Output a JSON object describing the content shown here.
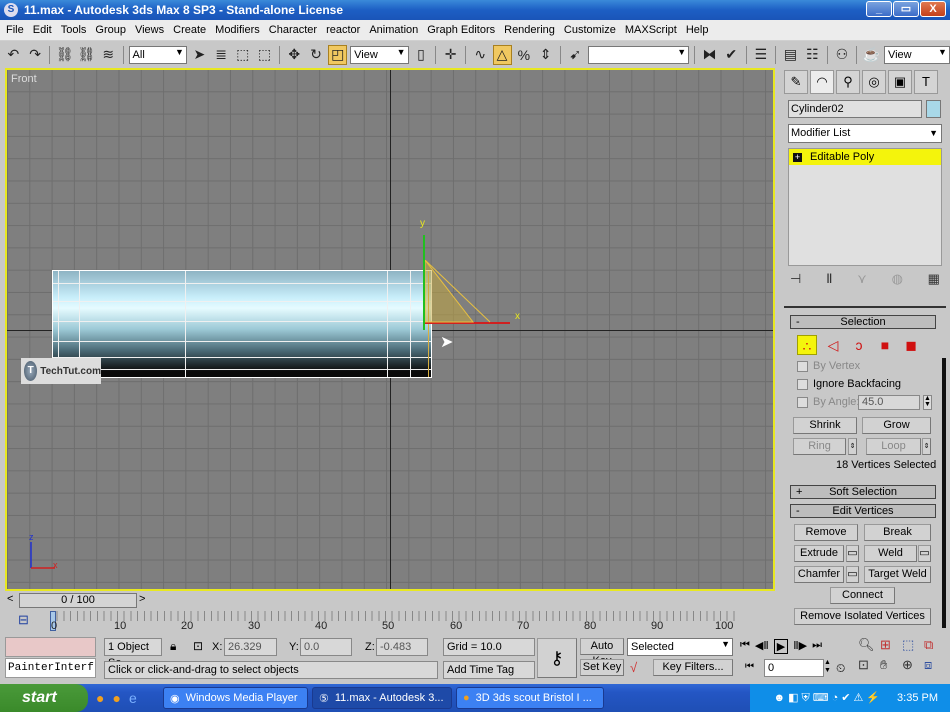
{
  "window": {
    "title": "11.max - Autodesk 3ds Max 8 SP3  - Stand-alone License",
    "minimize": "_",
    "restore": "▭",
    "close": "X"
  },
  "menu": [
    "File",
    "Edit",
    "Tools",
    "Group",
    "Views",
    "Create",
    "Modifiers",
    "Character",
    "reactor",
    "Animation",
    "Graph Editors",
    "Rendering",
    "Customize",
    "MAXScript",
    "Help"
  ],
  "toolbar": {
    "selection_filter": "All",
    "ref_coord": "View",
    "named_selection": "",
    "render_view": "View"
  },
  "viewport": {
    "label": "Front",
    "gizmo_y": "y",
    "gizmo_x": "x",
    "corner_z": "z",
    "corner_x": "x",
    "watermark": "TechTut.com"
  },
  "command_panel": {
    "object_name": "Cylinder02",
    "object_color": "#a8d8e8",
    "modifier_list": "Modifier List",
    "stack_item": "Editable Poly",
    "selection": {
      "title": "Selection",
      "collapse_sign": "-",
      "by_vertex": "By Vertex",
      "ignore_backfacing": "Ignore Backfacing",
      "by_angle": "By Angle:",
      "angle_value": "45.0",
      "shrink": "Shrink",
      "grow": "Grow",
      "ring": "Ring",
      "loop": "Loop",
      "status": "18 Vertices Selected"
    },
    "soft_selection": {
      "title": "Soft Selection",
      "sign": "+"
    },
    "edit_vertices": {
      "title": "Edit Vertices",
      "sign": "-",
      "remove": "Remove",
      "break": "Break",
      "extrude": "Extrude",
      "weld": "Weld",
      "chamfer": "Chamfer",
      "target_weld": "Target Weld",
      "connect": "Connect",
      "remove_isolated": "Remove Isolated Vertices"
    }
  },
  "timeline": {
    "slider": "0 / 100",
    "prev": "<",
    "next": ">",
    "tick_labels": [
      "0",
      "10",
      "20",
      "30",
      "40",
      "50",
      "60",
      "70",
      "80",
      "90",
      "100"
    ]
  },
  "status": {
    "script_listener": "PainterInterf",
    "selection_count": "1 Object Se",
    "x_label": "X:",
    "x": "26.329",
    "y_label": "Y:",
    "y": "0.0",
    "z_label": "Z:",
    "z": "-0.483",
    "grid": "Grid = 10.0",
    "prompt": "Click or click-and-drag to select objects",
    "add_time_tag": "Add Time Tag",
    "auto_key": "Auto Key",
    "set_key": "Set Key",
    "key_mode": "Selected",
    "key_filters": "Key Filters...",
    "current_frame": "0"
  },
  "taskbar": {
    "start": "start",
    "tasks": [
      "Windows Media Player",
      "11.max - Autodesk 3...",
      "3D 3ds scout Bristol I ..."
    ],
    "clock": "3:35 PM"
  }
}
